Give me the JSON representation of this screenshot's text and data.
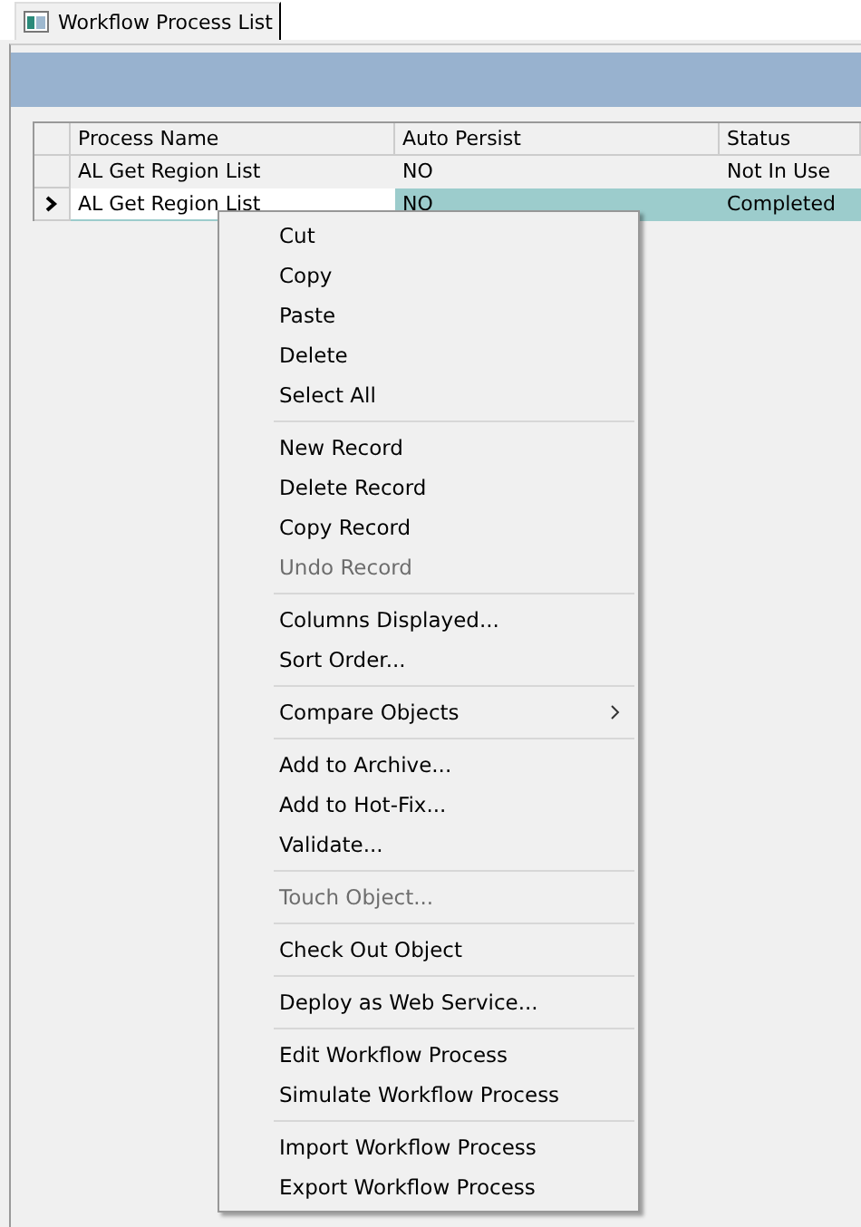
{
  "tab": {
    "title": "Workflow Process List"
  },
  "table": {
    "columns": [
      "Process Name",
      "Auto Persist",
      "Status"
    ],
    "rows": [
      {
        "selected": false,
        "current": false,
        "cells": [
          "AL Get Region List",
          "NO",
          "Not In Use"
        ]
      },
      {
        "selected": true,
        "current": true,
        "cells": [
          "AL Get Region List",
          "NO",
          "Completed"
        ]
      }
    ]
  },
  "context_menu": {
    "groups": [
      [
        {
          "label": "Cut",
          "disabled": false
        },
        {
          "label": "Copy",
          "disabled": false
        },
        {
          "label": "Paste",
          "disabled": false
        },
        {
          "label": "Delete",
          "disabled": false
        },
        {
          "label": "Select All",
          "disabled": false
        }
      ],
      [
        {
          "label": "New Record",
          "disabled": false
        },
        {
          "label": "Delete Record",
          "disabled": false
        },
        {
          "label": "Copy Record",
          "disabled": false
        },
        {
          "label": "Undo Record",
          "disabled": true
        }
      ],
      [
        {
          "label": "Columns Displayed...",
          "disabled": false
        },
        {
          "label": "Sort Order...",
          "disabled": false
        }
      ],
      [
        {
          "label": "Compare Objects",
          "disabled": false,
          "submenu": true
        }
      ],
      [
        {
          "label": "Add to Archive...",
          "disabled": false
        },
        {
          "label": "Add to Hot-Fix...",
          "disabled": false
        },
        {
          "label": "Validate...",
          "disabled": false
        }
      ],
      [
        {
          "label": "Touch Object...",
          "disabled": true
        }
      ],
      [
        {
          "label": "Check Out Object",
          "disabled": false
        }
      ],
      [
        {
          "label": "Deploy as Web Service...",
          "disabled": false
        }
      ],
      [
        {
          "label": "Edit Workflow Process",
          "disabled": false
        },
        {
          "label": "Simulate Workflow Process",
          "disabled": false
        }
      ],
      [
        {
          "label": "Import Workflow Process",
          "disabled": false
        },
        {
          "label": "Export Workflow Process",
          "disabled": false
        }
      ]
    ]
  }
}
